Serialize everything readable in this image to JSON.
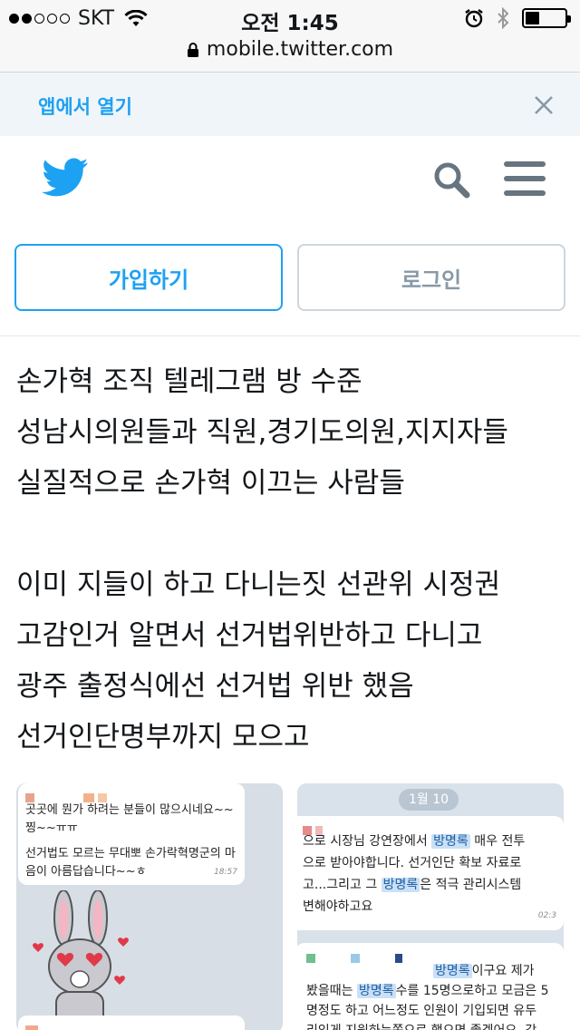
{
  "status_bar": {
    "carrier": "SKT",
    "time": "오전 1:45",
    "signal_bars_filled": 2,
    "signal_bars_total": 5,
    "battery_level_percent": 35
  },
  "url_bar": {
    "url": "mobile.twitter.com",
    "icon": "lock-icon"
  },
  "banner": {
    "open_in_app": "앱에서 열기",
    "close_icon": "close-icon"
  },
  "header": {
    "logo_icon": "twitter-bird-icon",
    "search_icon": "search-icon",
    "menu_icon": "hamburger-menu-icon"
  },
  "auth": {
    "signup_label": "가입하기",
    "login_label": "로그인"
  },
  "tweet": {
    "lines": [
      "손가혁 조직 텔레그램 방 수준",
      "성남시의원들과 직원,경기도의원,지지자들",
      "실질적으로 손가혁 이끄는 사람들",
      "",
      "이미 지들이 하고 다니는짓 선관위 시정권",
      "고감인거 알면서 선거법위반하고 다니고",
      "광주 출정식에선 선거법 위반 했음",
      "선거인단명부까지 모으고"
    ]
  },
  "media": {
    "left": {
      "message_1_line_1": "곳곳에 뭔가 하려는 분들이 많으시네요~~",
      "message_1_line_2": "찡~~ㅠㅠ",
      "message_1_line_3": "선거법도 모르는 무대뽀 손가락혁명군의 마",
      "message_1_line_4": "음이 아름답습니다~~ㅎ",
      "message_1_time": "18:57"
    },
    "right": {
      "date_pill": "1월 10",
      "b1_l1_pre": "으로  시장님 강연장에서 ",
      "b1_l1_hl": "방명록",
      "b1_l1_post": " 매우 전투",
      "b1_l2": "으로 받아야합니다.  선거인단 확보 자료로",
      "b1_l3_pre": "고...그리고 그 ",
      "b1_l3_hl": "방명록",
      "b1_l3_post": "은  적극 관리시스템",
      "b1_l4": "변해야하고요",
      "b1_time": "02:3",
      "b2_l1_hl": "방명록",
      "b2_l1_post": "이구요 제가",
      "b2_l2_pre": "봤을때는 ",
      "b2_l2_hl": "방명록",
      "b2_l2_post": "수를 15명으로하고 모금은 5",
      "b2_l3": "명정도 하고 어느정도 인원이 기입되면 유두",
      "b2_l4": "리있게 지원하는쪽으로 했으면 좋겠어요. 각"
    }
  },
  "colors": {
    "twitter_blue": "#1da1f2",
    "muted_gray": "#8899a6",
    "highlight": "#c9e0f7"
  }
}
